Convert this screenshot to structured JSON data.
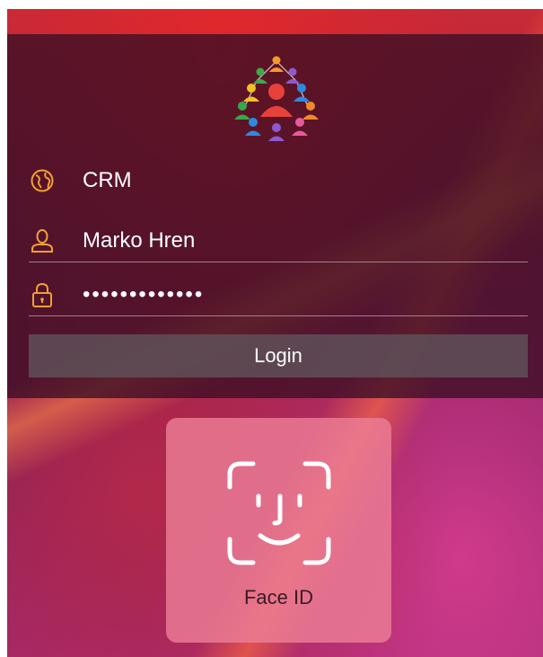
{
  "login": {
    "logo_icon": "people-network-logo-icon",
    "company": {
      "icon": "globe-icon",
      "value": "CRM"
    },
    "username": {
      "icon": "user-icon",
      "value": "Marko Hren"
    },
    "password": {
      "icon": "lock-icon",
      "masked_value": "•••••••••••••"
    },
    "login_button_label": "Login"
  },
  "face_id": {
    "icon": "face-id-icon",
    "label": "Face ID"
  },
  "colors": {
    "accent_orange": "#f0a030",
    "panel_bg": "#3a0e24",
    "button_bg": "#5f5058",
    "faceid_card_bg": "#ec7e96"
  }
}
